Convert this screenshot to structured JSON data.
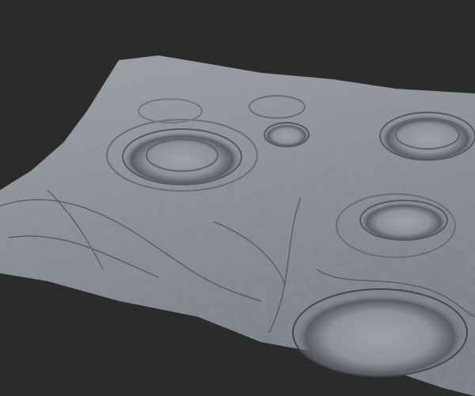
{
  "colors": {
    "background": "#2b2b2b",
    "terrain_light": "#a9aeb5",
    "terrain_mid": "#858a91",
    "terrain_dark": "#4e5258"
  }
}
